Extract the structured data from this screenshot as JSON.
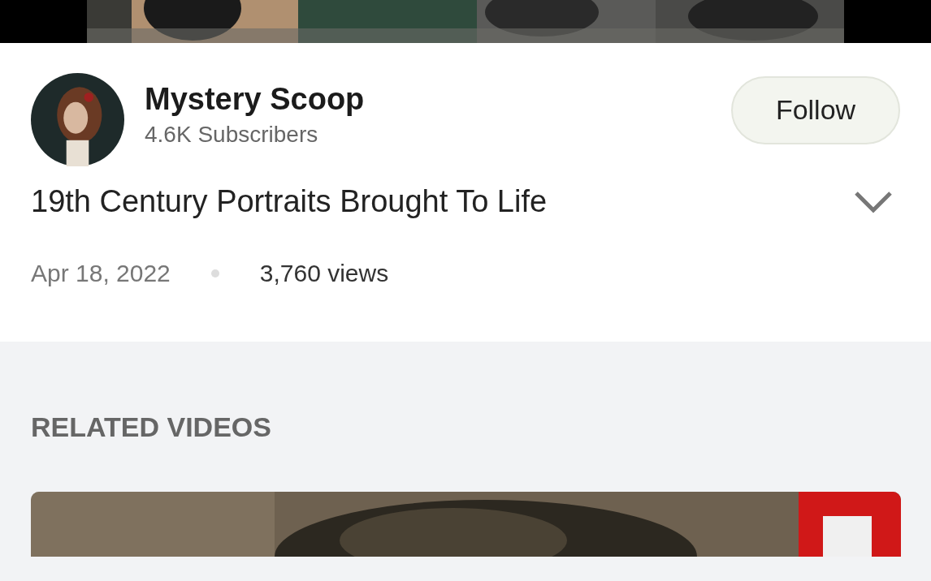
{
  "channel": {
    "name": "Mystery Scoop",
    "subscribers": "4.6K Subscribers",
    "follow_button": "Follow"
  },
  "video": {
    "title": "19th Century Portraits Brought To Life",
    "expanded": false,
    "date": "Apr 18, 2022",
    "views": "3,760 views"
  },
  "related": {
    "heading": "RELATED VIDEOS"
  }
}
